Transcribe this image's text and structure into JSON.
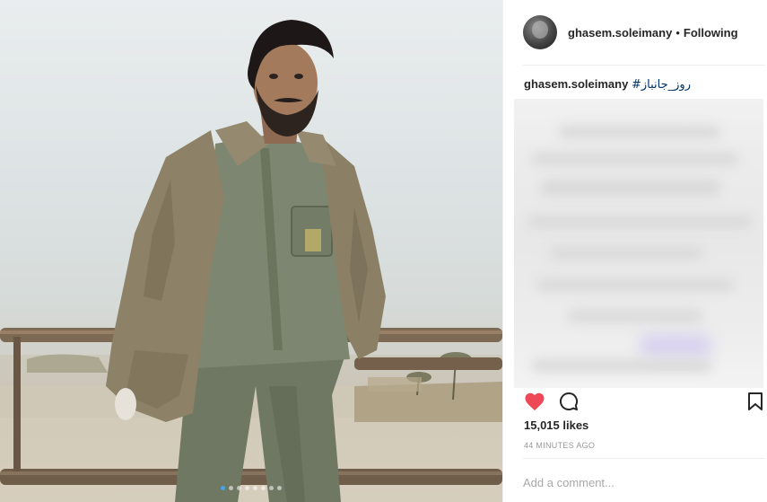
{
  "post": {
    "username": "ghasem.soleimany",
    "separator": "•",
    "follow_status": "Following",
    "caption": {
      "username": "ghasem.soleimany",
      "hashtag": "#روز_جانباز"
    },
    "likes": "15,015 likes",
    "time": "44 MINUTES AGO",
    "comment_placeholder": "Add a comment..."
  },
  "carousel": {
    "count": 8,
    "active_index": 0
  },
  "colors": {
    "like_active": "#ed4956",
    "text": "#262626",
    "muted": "#999999",
    "hashtag": "#003569",
    "carousel_active": "#4aa3e6"
  },
  "icons": {
    "like": "heart-filled-icon",
    "comment": "comment-bubble-icon",
    "save": "bookmark-icon"
  }
}
